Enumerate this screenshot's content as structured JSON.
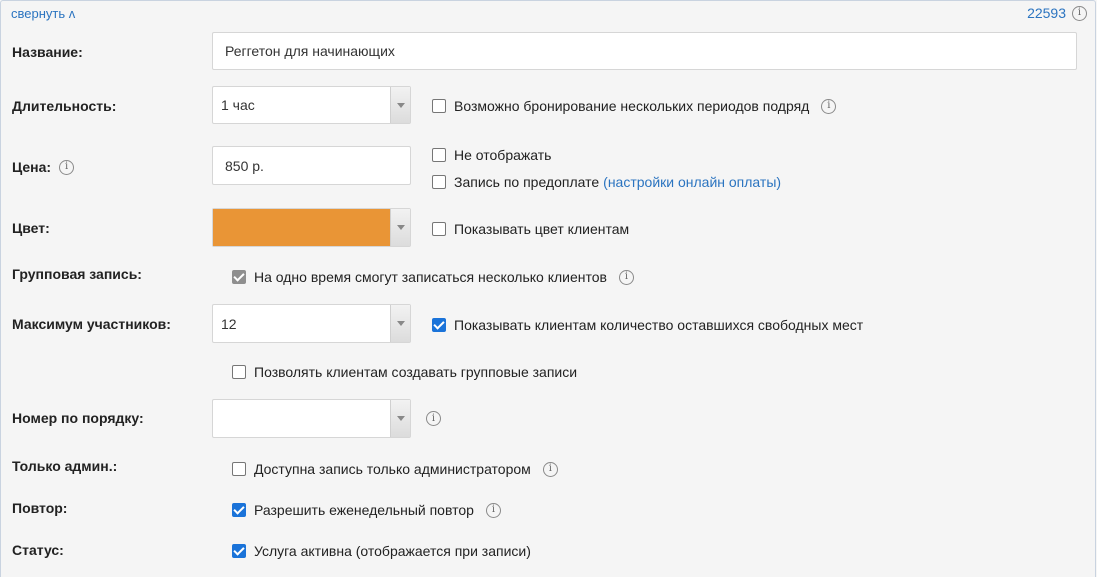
{
  "header": {
    "collapse_label": "свернуть ʌ",
    "service_id": "22593"
  },
  "fields": {
    "name": {
      "label": "Название:",
      "value": "Реггетон для начинающих"
    },
    "duration": {
      "label": "Длительность:",
      "value": "1 час",
      "multi_period_label": "Возможно бронирование нескольких периодов подряд"
    },
    "price": {
      "label": "Цена:",
      "value": "850 р.",
      "hide_label": "Не отображать",
      "prepay_label": "Запись по предоплате",
      "prepay_link": "(настройки онлайн оплаты)"
    },
    "color": {
      "label": "Цвет:",
      "value_hex": "#E99536",
      "show_color_label": "Показывать цвет клиентам"
    },
    "group": {
      "label": "Групповая запись:",
      "multi_clients_label": "На одно время смогут записаться несколько клиентов"
    },
    "max_participants": {
      "label": "Максимум участников:",
      "value": "12",
      "show_free_label": "Показывать клиентам количество оставшихся свободных мест",
      "allow_group_label": "Позволять клиентам создавать групповые записи"
    },
    "order": {
      "label": "Номер по порядку:",
      "value": ""
    },
    "admin_only": {
      "label": "Только админ.:",
      "checkbox_label": "Доступна запись только администратором"
    },
    "repeat": {
      "label": "Повтор:",
      "checkbox_label": "Разрешить еженедельный повтор"
    },
    "status": {
      "label": "Статус:",
      "checkbox_label": "Услуга активна (отображается при записи)"
    }
  },
  "state": {
    "multi_period": false,
    "hide_price": false,
    "prepay": false,
    "show_color": false,
    "multi_clients": true,
    "show_free": true,
    "allow_group": false,
    "admin_only": false,
    "repeat": true,
    "active": true
  },
  "colors": {
    "accent": "#2b74c0",
    "checkbox_on": "#1a73d9",
    "service_color": "#E99536"
  },
  "icons": [
    "info-icon",
    "chevron-down-icon",
    "check-icon"
  ]
}
